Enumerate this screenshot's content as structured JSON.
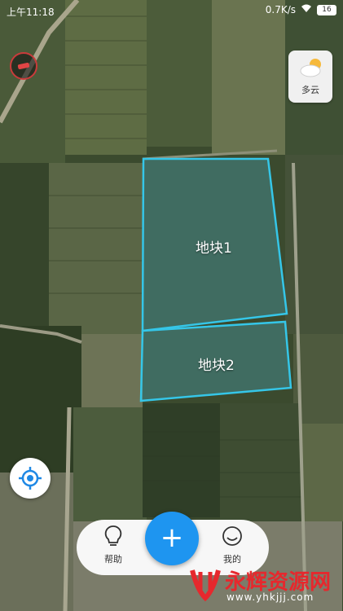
{
  "status_bar": {
    "time": "上午11:18",
    "network_speed": "0.7K/s",
    "battery": "16"
  },
  "weather": {
    "label": "多云",
    "icon": "cloud-sun-icon"
  },
  "plots": [
    {
      "name": "地块1"
    },
    {
      "name": "地块2"
    }
  ],
  "bottom_nav": {
    "help_label": "帮助",
    "add_label": "+",
    "mine_label": "我的"
  },
  "watermark": {
    "name": "永辉资源网",
    "url": "www.yhkjjj.com"
  },
  "colors": {
    "plot_outline": "#35c6e8",
    "accent": "#1e95f0",
    "watermark": "#e6282d"
  }
}
